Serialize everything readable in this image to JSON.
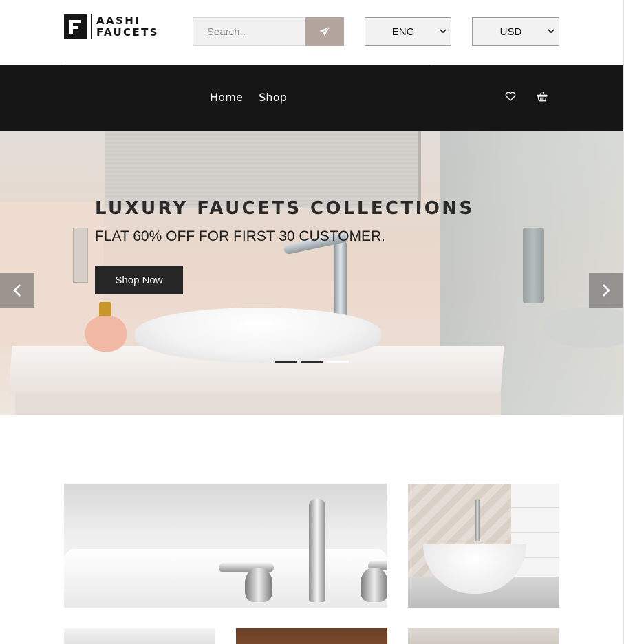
{
  "header": {
    "logo": {
      "line1": "AASHI",
      "line2": "FAUCETS"
    },
    "search": {
      "placeholder": "Search..",
      "icon": "paper-plane-icon"
    },
    "language": {
      "selected": "ENG",
      "icon": "chevron-down-icon"
    },
    "currency": {
      "selected": "USD",
      "icon": "chevron-down-icon"
    }
  },
  "nav": {
    "links": [
      {
        "label": "Home"
      },
      {
        "label": "Shop"
      }
    ],
    "icons": [
      "heart-icon",
      "basket-icon"
    ]
  },
  "hero": {
    "title": "LUXURY FAUCETS COLLECTIONS",
    "subtitle": "FLAT 60% OFF FOR FIRST 30 CUSTOMER.",
    "cta_label": "Shop Now",
    "slide_count": 3,
    "active_slide": 1,
    "prev_icon": "chevron-left-icon",
    "next_icon": "chevron-right-icon"
  },
  "colors": {
    "nav_bg": "#161616",
    "search_button": "#b3a49d",
    "cta_bg": "#262626"
  },
  "products": [
    {
      "image": "bathtub-faucet-image"
    },
    {
      "image": "vessel-sink-image"
    },
    {
      "image": "product-image"
    },
    {
      "image": "product-image"
    },
    {
      "image": "product-image"
    }
  ]
}
